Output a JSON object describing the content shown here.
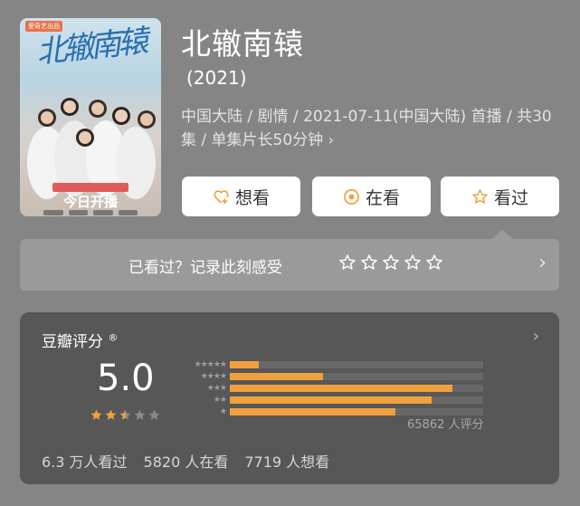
{
  "poster": {
    "tag": "爱奇艺出品",
    "calligraphy": "北辙南辕",
    "premiere": "今日开播"
  },
  "header": {
    "title": "北辙南辕",
    "year": "(2021)",
    "meta": "中国大陆 / 剧情 / 2021-07-11(中国大陆) 首播 / 共30集 / 单集片长50分钟"
  },
  "actions": {
    "want": "想看",
    "watching": "在看",
    "watched": "看过"
  },
  "rate_prompt": {
    "text": "已看过？记录此刻感受",
    "stars": 5
  },
  "rating": {
    "label": "豆瓣评分",
    "registered": "®",
    "score": "5.0",
    "stars_fraction": 0.5,
    "distribution": [
      {
        "stars": "★★★★★",
        "percent": 4
      },
      {
        "stars": "★★★★",
        "percent": 13
      },
      {
        "stars": "★★★",
        "percent": 31
      },
      {
        "stars": "★★",
        "percent": 28
      },
      {
        "stars": "★",
        "percent": 23
      }
    ],
    "count": "65862 人评分",
    "watched": "6.3 万人看过",
    "watching": "5820 人在看",
    "want": "7719 人想看"
  },
  "colors": {
    "accent": "#f0a13e",
    "background": "#858585",
    "card": "#575757"
  }
}
